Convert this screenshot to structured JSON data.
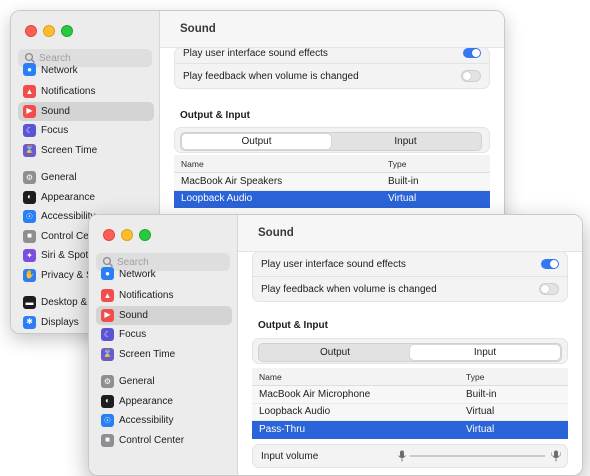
{
  "search": {
    "placeholder": "Search"
  },
  "back_window": {
    "title": "Sound",
    "sidebar": {
      "partial_top": "Network",
      "items": [
        {
          "label": "Notifications",
          "icon": "bell-icon",
          "color": "#f24d4d"
        },
        {
          "label": "Sound",
          "icon": "speaker-icon",
          "color": "#f24d4d"
        },
        {
          "label": "Focus",
          "icon": "moon-icon",
          "color": "#5b55d6"
        },
        {
          "label": "Screen Time",
          "icon": "hourglass-icon",
          "color": "#6a5acd"
        },
        {
          "label": "General",
          "icon": "gear-icon",
          "color": "#8e8e93"
        },
        {
          "label": "Appearance",
          "icon": "appearance-icon",
          "color": "#1d1d1f"
        },
        {
          "label": "Accessibility",
          "icon": "accessibility-icon",
          "color": "#2a7ff6"
        },
        {
          "label": "Control Center",
          "icon": "control-center-icon",
          "color": "#8e8e93"
        },
        {
          "label": "Siri & Spotlight",
          "icon": "siri-icon",
          "color": "#7a4fe0"
        },
        {
          "label": "Privacy & Security",
          "icon": "hand-icon",
          "color": "#2a7ff6"
        },
        {
          "label": "Desktop & Dock",
          "icon": "desktop-icon",
          "color": "#1d1d1f"
        },
        {
          "label": "Displays",
          "icon": "displays-icon",
          "color": "#2a7ff6"
        }
      ]
    },
    "sound_effects": {
      "ui_sounds_label": "Play user interface sound effects",
      "feedback_label": "Play feedback when volume is changed"
    },
    "section_title": "Output & Input",
    "tabs": [
      "Output",
      "Input"
    ],
    "active_tab": "Output",
    "table": {
      "headers": [
        "Name",
        "Type"
      ],
      "rows": [
        {
          "name": "MacBook Air Speakers",
          "type": "Built-in"
        },
        {
          "name": "Loopback Audio",
          "type": "Virtual"
        }
      ],
      "selected": "Loopback Audio"
    }
  },
  "front_window": {
    "title": "Sound",
    "sidebar": {
      "partial_top": "Network",
      "items": [
        {
          "label": "Notifications",
          "icon": "bell-icon",
          "color": "#f24d4d"
        },
        {
          "label": "Sound",
          "icon": "speaker-icon",
          "color": "#f24d4d"
        },
        {
          "label": "Focus",
          "icon": "moon-icon",
          "color": "#5b55d6"
        },
        {
          "label": "Screen Time",
          "icon": "hourglass-icon",
          "color": "#6a5acd"
        },
        {
          "label": "General",
          "icon": "gear-icon",
          "color": "#8e8e93"
        },
        {
          "label": "Appearance",
          "icon": "appearance-icon",
          "color": "#1d1d1f"
        },
        {
          "label": "Accessibility",
          "icon": "accessibility-icon",
          "color": "#2a7ff6"
        },
        {
          "label": "Control Center",
          "icon": "control-center-icon",
          "color": "#8e8e93"
        }
      ]
    },
    "sound_effects": {
      "ui_sounds_label": "Play user interface sound effects",
      "feedback_label": "Play feedback when volume is changed"
    },
    "section_title": "Output & Input",
    "tabs": [
      "Output",
      "Input"
    ],
    "active_tab": "Input",
    "table": {
      "headers": [
        "Name",
        "Type"
      ],
      "rows": [
        {
          "name": "MacBook Air Microphone",
          "type": "Built-in"
        },
        {
          "name": "Loopback Audio",
          "type": "Virtual"
        },
        {
          "name": "Pass-Thru",
          "type": "Virtual"
        }
      ],
      "selected": "Pass-Thru"
    },
    "input_volume_label": "Input volume"
  },
  "colors": {
    "accent": "#3478f6",
    "selection": "#2b64d9"
  }
}
